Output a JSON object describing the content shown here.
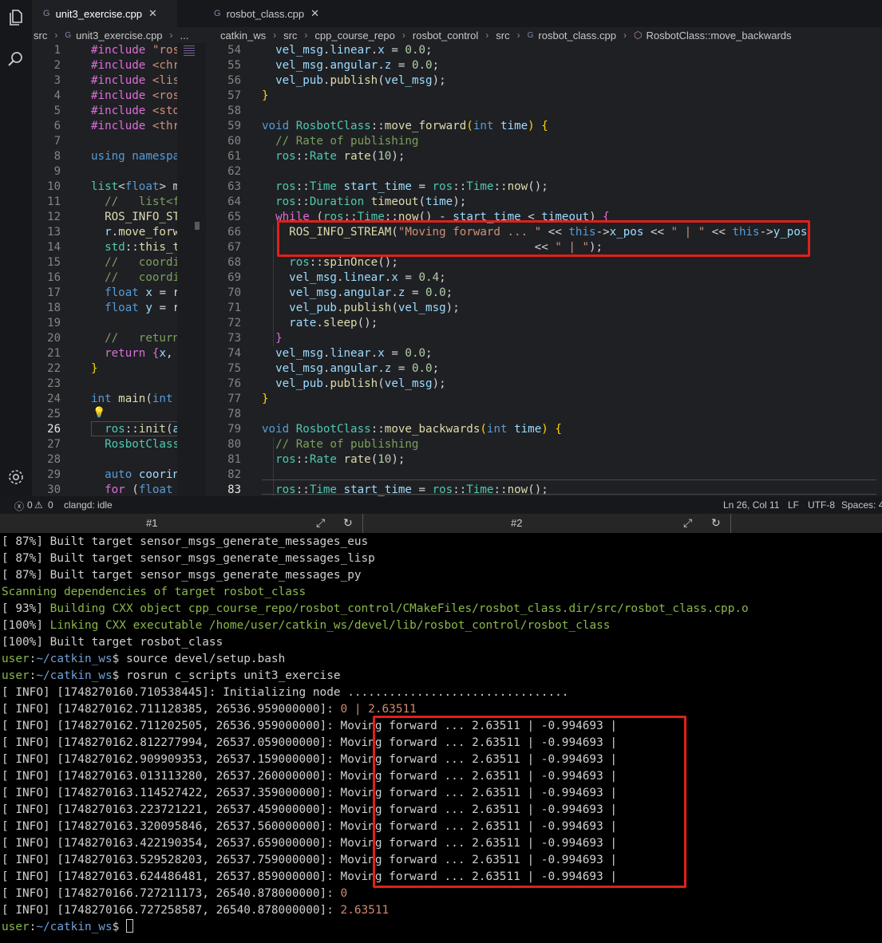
{
  "editor": {
    "tabs": [
      {
        "label": "unit3_exercise.cpp",
        "active": true
      },
      {
        "label": "rosbot_class.cpp",
        "active": false
      }
    ],
    "breadcrumbs_left": [
      "src",
      "unit3_exercise.cpp",
      "..."
    ],
    "breadcrumbs_right": [
      "catkin_ws",
      "src",
      "cpp_course_repo",
      "rosbot_control",
      "src",
      "rosbot_class.cpp",
      "RosbotClass::move_backwards"
    ],
    "left_lines": [
      {
        "n": "1",
        "h": "<span class='p'>#include</span> <span class='s'>\"ros</span>"
      },
      {
        "n": "2",
        "h": "<span class='p'>#include</span> <span class='s'>&lt;chr</span>"
      },
      {
        "n": "3",
        "h": "<span class='p'>#include</span> <span class='s'>&lt;lis</span>"
      },
      {
        "n": "4",
        "h": "<span class='p'>#include</span> <span class='s'>&lt;ros</span>"
      },
      {
        "n": "5",
        "h": "<span class='p'>#include</span> <span class='s'>&lt;std</span>"
      },
      {
        "n": "6",
        "h": "<span class='p'>#include</span> <span class='s'>&lt;thr</span>"
      },
      {
        "n": "7",
        "h": ""
      },
      {
        "n": "8",
        "h": "<span class='k'>using</span> <span class='k'>namespa</span>"
      },
      {
        "n": "9",
        "h": ""
      },
      {
        "n": "10",
        "h": "<span class='t'>list</span>&lt;<span class='k'>float</span>&gt; m"
      },
      {
        "n": "11",
        "h": "  <span class='c'>//   list&lt;f</span>"
      },
      {
        "n": "12",
        "h": "  <span class='f'>ROS_INFO_ST</span>"
      },
      {
        "n": "13",
        "h": "  <span class='v'>r</span>.<span class='f'>move_forw</span>"
      },
      {
        "n": "14",
        "h": "  <span class='t'>std</span>::<span class='f'>this_t</span>"
      },
      {
        "n": "15",
        "h": "  <span class='c'>//   coordi</span>"
      },
      {
        "n": "16",
        "h": "  <span class='c'>//   coordi</span>"
      },
      {
        "n": "17",
        "h": "  <span class='k'>float</span> <span class='v'>x</span> = r"
      },
      {
        "n": "18",
        "h": "  <span class='k'>float</span> <span class='v'>y</span> = r"
      },
      {
        "n": "19",
        "h": ""
      },
      {
        "n": "20",
        "h": "  <span class='c'>//   return</span>"
      },
      {
        "n": "21",
        "h": "  <span class='p'>return</span> <span class='p'>{</span><span class='v'>x</span>,"
      },
      {
        "n": "22",
        "h": "<span class='y'>}</span>"
      },
      {
        "n": "23",
        "h": ""
      },
      {
        "n": "24",
        "h": "<span class='k'>int</span> <span class='f'>main</span>(<span class='k'>int</span>"
      },
      {
        "n": "25",
        "h": ""
      },
      {
        "n": "26",
        "h": "  <span class='t'>ros</span>::<span class='f'>init</span>(<span class='v'>a</span>"
      },
      {
        "n": "27",
        "h": "  <span class='t'>RosbotClass</span>"
      },
      {
        "n": "28",
        "h": ""
      },
      {
        "n": "29",
        "h": "  <span class='k'>auto</span> <span class='v'>coorin</span>"
      },
      {
        "n": "30",
        "h": "  <span class='p'>for</span> (<span class='k'>float</span>"
      }
    ],
    "right_lines": [
      {
        "n": "54",
        "h": "  <span class='v'>vel_msg</span>.<span class='v'>linear</span>.<span class='v'>x</span> = <span class='n'>0.0</span>;"
      },
      {
        "n": "55",
        "h": "  <span class='v'>vel_msg</span>.<span class='v'>angular</span>.<span class='v'>z</span> = <span class='n'>0.0</span>;"
      },
      {
        "n": "56",
        "h": "  <span class='v'>vel_pub</span>.<span class='f'>publish</span>(<span class='v'>vel_msg</span>);"
      },
      {
        "n": "57",
        "h": "<span class='y'>}</span>"
      },
      {
        "n": "58",
        "h": ""
      },
      {
        "n": "59",
        "h": "<span class='k'>void</span> <span class='t'>RosbotClass</span>::<span class='f'>move_forward</span><span class='y'>(</span><span class='k'>int</span> <span class='v'>time</span><span class='y'>)</span> <span class='y'>{</span>"
      },
      {
        "n": "60",
        "h": "  <span class='c'>// Rate of publishing</span>"
      },
      {
        "n": "61",
        "h": "  <span class='t'>ros</span>::<span class='t'>Rate</span> <span class='f'>rate</span>(<span class='n'>10</span>);"
      },
      {
        "n": "62",
        "h": ""
      },
      {
        "n": "63",
        "h": "  <span class='t'>ros</span>::<span class='t'>Time</span> <span class='v'>start_time</span> = <span class='t'>ros</span>::<span class='t'>Time</span>::<span class='f'>now</span>();"
      },
      {
        "n": "64",
        "h": "  <span class='t'>ros</span>::<span class='t'>Duration</span> <span class='f'>timeout</span>(<span class='v'>time</span>);"
      },
      {
        "n": "65",
        "h": "  <span class='p'>while</span> (<span class='t'>ros</span>::<span class='t'>Time</span>::<span class='f'>now</span>() - <span class='v'>start_time</span> &lt; <span class='v'>timeout</span>) <span class='p'>{</span>"
      },
      {
        "n": "66",
        "h": "    <span class='f'>ROS_INFO_STREAM</span>(<span class='s'>\"Moving forward ... \"</span> &lt;&lt; <span class='k'>this</span>-&gt;<span class='v'>x_pos</span> &lt;&lt; <span class='s'>\" | \"</span> &lt;&lt; <span class='k'>this</span>-&gt;<span class='v'>y_pos</span>"
      },
      {
        "n": "67",
        "h": "                                        &lt;&lt; <span class='s'>\" | \"</span>);"
      },
      {
        "n": "68",
        "h": "    <span class='t'>ros</span>::<span class='f'>spinOnce</span>();"
      },
      {
        "n": "69",
        "h": "    <span class='v'>vel_msg</span>.<span class='v'>linear</span>.<span class='v'>x</span> = <span class='n'>0.4</span>;"
      },
      {
        "n": "70",
        "h": "    <span class='v'>vel_msg</span>.<span class='v'>angular</span>.<span class='v'>z</span> = <span class='n'>0.0</span>;"
      },
      {
        "n": "71",
        "h": "    <span class='v'>vel_pub</span>.<span class='f'>publish</span>(<span class='v'>vel_msg</span>);"
      },
      {
        "n": "72",
        "h": "    <span class='v'>rate</span>.<span class='f'>sleep</span>();"
      },
      {
        "n": "73",
        "h": "  <span class='p'>}</span>"
      },
      {
        "n": "74",
        "h": "  <span class='v'>vel_msg</span>.<span class='v'>linear</span>.<span class='v'>x</span> = <span class='n'>0.0</span>;"
      },
      {
        "n": "75",
        "h": "  <span class='v'>vel_msg</span>.<span class='v'>angular</span>.<span class='v'>z</span> = <span class='n'>0.0</span>;"
      },
      {
        "n": "76",
        "h": "  <span class='v'>vel_pub</span>.<span class='f'>publish</span>(<span class='v'>vel_msg</span>);"
      },
      {
        "n": "77",
        "h": "<span class='y'>}</span>"
      },
      {
        "n": "78",
        "h": ""
      },
      {
        "n": "79",
        "h": "<span class='k'>void</span> <span class='t'>RosbotClass</span>::<span class='f'>move_backwards</span><span class='y'>(</span><span class='k'>int</span> <span class='v'>time</span><span class='y'>)</span> <span class='y'>{</span>"
      },
      {
        "n": "80",
        "h": "  <span class='c'>// Rate of publishing</span>"
      },
      {
        "n": "81",
        "h": "  <span class='t'>ros</span>::<span class='t'>Rate</span> <span class='f'>rate</span>(<span class='n'>10</span>);"
      },
      {
        "n": "82",
        "h": ""
      },
      {
        "n": "83",
        "h": "  <span class='t'>ros</span>::<span class='t'>Time</span> <span class='v'>start_time</span> = <span class='t'>ros</span>::<span class='t'>Time</span>::<span class='f'>now</span>();"
      }
    ]
  },
  "status_bar": {
    "errors": "0",
    "warnings": "0",
    "language_server": "clangd: idle",
    "cursor": "Ln 26, Col 11",
    "eol": "LF",
    "encoding": "UTF-8",
    "indent": "Spaces: 4"
  },
  "terminal_tabs": [
    {
      "label": "#1"
    },
    {
      "label": "#2"
    }
  ],
  "terminal": {
    "lines": [
      {
        "h": "[ 87%] Built target sensor_msgs_generate_messages_eus"
      },
      {
        "h": "[ 87%] Built target sensor_msgs_generate_messages_lisp"
      },
      {
        "h": "[ 87%] Built target sensor_msgs_generate_messages_py"
      },
      {
        "h": "<span class='tg'>Scanning dependencies of target rosbot_class</span>"
      },
      {
        "h": "[ 93%] <span class='tg'>Building CXX object cpp_course_repo/rosbot_control/CMakeFiles/rosbot_class.dir/src/rosbot_class.cpp.o</span>"
      },
      {
        "h": "[100%] <span class='tg'>Linking CXX executable /home/user/catkin_ws/devel/lib/rosbot_control/rosbot_class</span>"
      },
      {
        "h": "[100%] Built target rosbot_class"
      },
      {
        "h": "<span class='tp'>user</span>:<span class='tpath'>~/catkin_ws</span>$ source devel/setup.bash"
      },
      {
        "h": "<span class='tp'>user</span>:<span class='tpath'>~/catkin_ws</span>$ rosrun c_scripts unit3_exercise"
      },
      {
        "h": "[ INFO] [1748270160.710538445]: Initializing node ................................"
      },
      {
        "h": "[ INFO] [1748270162.711128385, 26536.959000000]: <span class='to'>0 | 2.63511</span>"
      },
      {
        "h": "[ INFO] [1748270162.711202505, 26536.959000000]: Moving forward ... 2.63511 | -0.994693 |"
      },
      {
        "h": "[ INFO] [1748270162.812277994, 26537.059000000]: Moving forward ... 2.63511 | -0.994693 |"
      },
      {
        "h": "[ INFO] [1748270162.909909353, 26537.159000000]: Moving forward ... 2.63511 | -0.994693 |"
      },
      {
        "h": "[ INFO] [1748270163.013113280, 26537.260000000]: Moving forward ... 2.63511 | -0.994693 |"
      },
      {
        "h": "[ INFO] [1748270163.114527422, 26537.359000000]: Moving forward ... 2.63511 | -0.994693 |"
      },
      {
        "h": "[ INFO] [1748270163.223721221, 26537.459000000]: Moving forward ... 2.63511 | -0.994693 |"
      },
      {
        "h": "[ INFO] [1748270163.320095846, 26537.560000000]: Moving forward ... 2.63511 | -0.994693 |"
      },
      {
        "h": "[ INFO] [1748270163.422190354, 26537.659000000]: Moving forward ... 2.63511 | -0.994693 |"
      },
      {
        "h": "[ INFO] [1748270163.529528203, 26537.759000000]: Moving forward ... 2.63511 | -0.994693 |"
      },
      {
        "h": "[ INFO] [1748270163.624486481, 26537.859000000]: Moving forward ... 2.63511 | -0.994693 |"
      },
      {
        "h": "[ INFO] [1748270166.727211173, 26540.878000000]: <span class='to'>0</span>"
      },
      {
        "h": "[ INFO] [1748270166.727258587, 26540.878000000]: <span class='to'>2.63511</span>"
      },
      {
        "h": "<span class='tp'>user</span>:<span class='tpath'>~/catkin_ws</span>$ <span style='display:inline-block;width:9px;height:17px;border:1px solid #cfcfcf;vertical-align:-3px'></span>"
      }
    ]
  },
  "colors": {
    "highlight_box": "#e0201a",
    "editor_bg": "#1f2024",
    "terminal_bg": "#000000"
  },
  "icons": [
    "files-icon",
    "search-icon",
    "gear-icon",
    "lightbulb-icon",
    "maximize-icon",
    "restart-icon"
  ]
}
